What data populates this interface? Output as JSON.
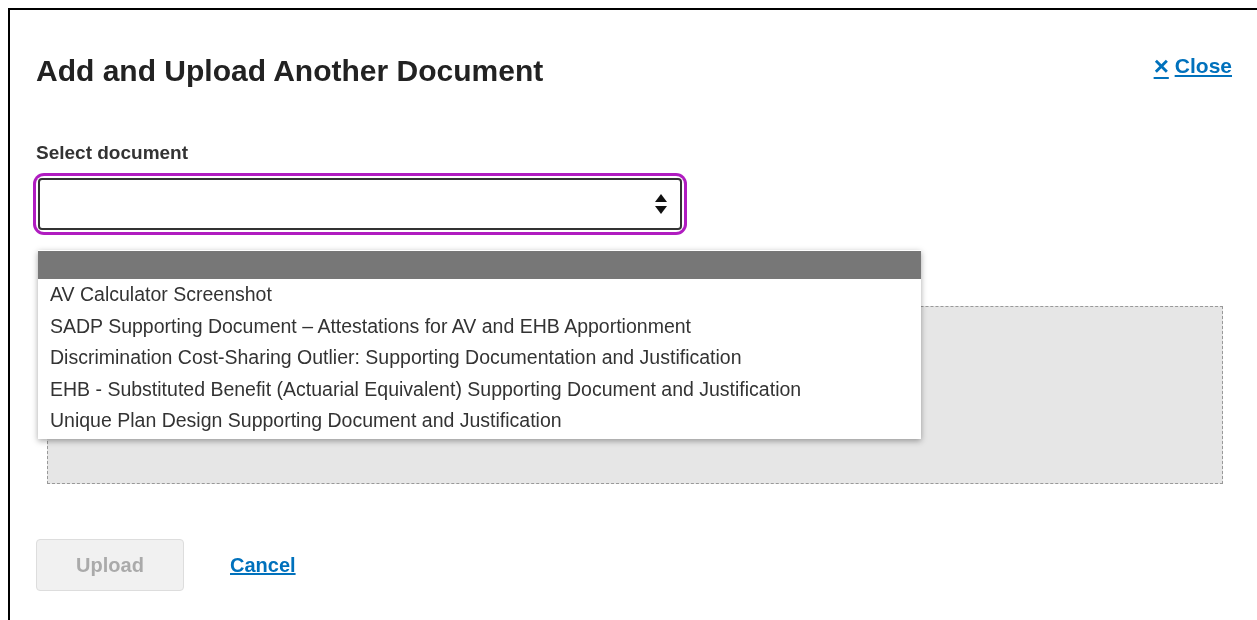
{
  "dialog": {
    "title": "Add and Upload Another Document",
    "close_link": {
      "icon": "×",
      "label": "Close"
    }
  },
  "select": {
    "label": "Select document",
    "focused": true,
    "expanded": true,
    "options": [
      {
        "selected": true
      },
      {
        "label": "AV Calculator Screenshot",
        "selected": false
      },
      {
        "label": "SADP Supporting Document – Attestations for AV and EHB Apportionment",
        "selected": false
      },
      {
        "label": "Discrimination Cost-Sharing Outlier: Supporting Documentation and Justification",
        "selected": false
      },
      {
        "label": "EHB - Substituted Benefit (Actuarial Equivalent) Supporting Document and Justification",
        "selected": false
      },
      {
        "label": "Unique Plan Design Supporting Document and Justification",
        "selected": false
      }
    ]
  },
  "buttons": [
    {
      "kind": "button",
      "label": "Upload",
      "disabled": true
    },
    {
      "kind": "link",
      "label": "Cancel",
      "disabled": false
    }
  ]
}
